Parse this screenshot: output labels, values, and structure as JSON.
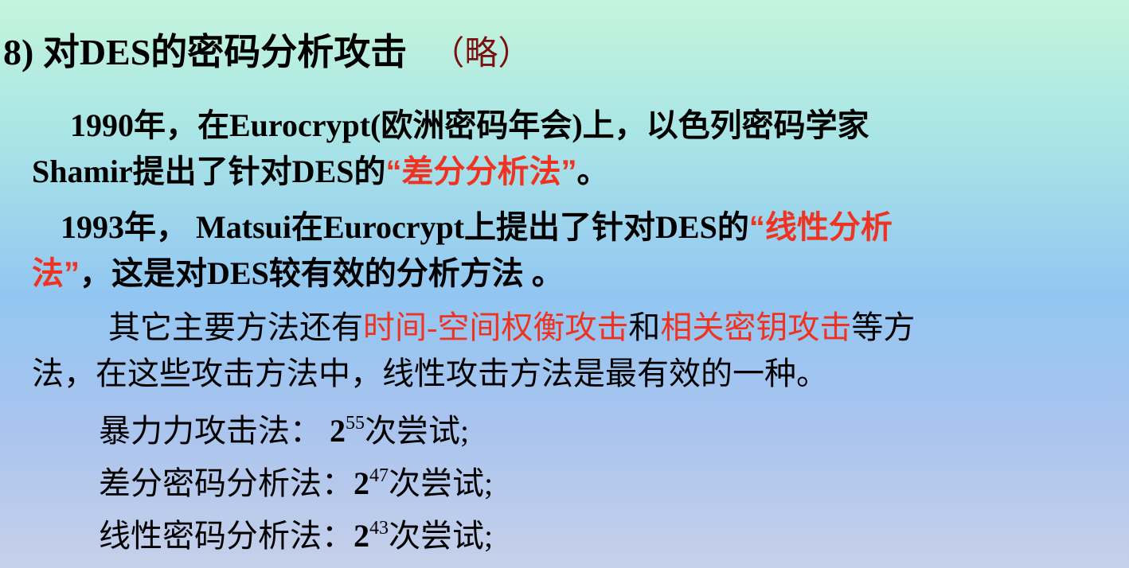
{
  "title": {
    "text": "8) 对DES的密码分析攻击",
    "note": "（略）"
  },
  "p1": {
    "line1": "1990年，在Eurocrypt(欧洲密码年会)上，以色列密码学家",
    "line2_a": "Shamir提出了针对DES的",
    "line2_em": "“差分分析法”",
    "line2_b": "。"
  },
  "p2": {
    "line1_a": "1993年， Matsui在Eurocrypt上提出了针对DES的",
    "line1_em": "“线性分析",
    "line2_em": "法”",
    "line2_b": "，这是对DES较有效的分析方法 。"
  },
  "p3": {
    "line1_a": "其它主要方法还有",
    "em1": "时间-空间权衡攻击",
    "mid": "和",
    "em2": "相关密钥攻击",
    "line1_b": "等方",
    "line2": "法，在这些攻击方法中，线性攻击方法是最有效的一种。"
  },
  "list": [
    {
      "label": "暴力力攻击法： ",
      "base": "2",
      "exp": "55",
      "suffix": "次尝试;"
    },
    {
      "label": "差分密码分析法：",
      "base": "2",
      "exp": "47",
      "suffix": "次尝试;"
    },
    {
      "label": "线性密码分析法：",
      "base": "2",
      "exp": "43",
      "suffix": "次尝试;"
    }
  ],
  "colors": {
    "emphasis": "#ee3322",
    "note": "#7a1010"
  }
}
